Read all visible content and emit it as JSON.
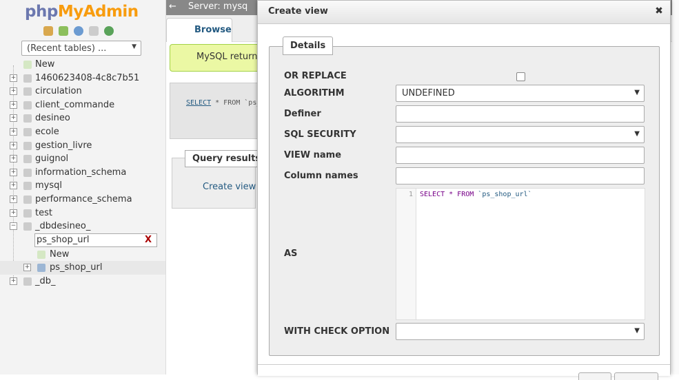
{
  "nav": {
    "logo_php": "php",
    "logo_myadmin": "MyAdmin",
    "recent_tables": "(Recent tables) ...",
    "tree": [
      {
        "label": "New",
        "expander": ""
      },
      {
        "label": "1460623408-4c8c7b51",
        "expander": "+"
      },
      {
        "label": "circulation",
        "expander": "+"
      },
      {
        "label": "client_commande",
        "expander": "+"
      },
      {
        "label": "desineo",
        "expander": "+"
      },
      {
        "label": "ecole",
        "expander": "+"
      },
      {
        "label": "gestion_livre",
        "expander": "+"
      },
      {
        "label": "guignol",
        "expander": "+"
      },
      {
        "label": "information_schema",
        "expander": "+"
      },
      {
        "label": "mysql",
        "expander": "+"
      },
      {
        "label": "performance_schema",
        "expander": "+"
      },
      {
        "label": "test",
        "expander": "+"
      },
      {
        "label": "_dbdesineo_",
        "expander": "−"
      }
    ],
    "filter_value": "ps_shop_url",
    "filter_clear": "X",
    "sub_new": "New",
    "sub_table": "ps_shop_url",
    "last_db": "_db_"
  },
  "background": {
    "back_arrow": "←",
    "server": "Server: mysq",
    "tab_browse": "Browse",
    "success_text": "MySQL returne",
    "sql_select": "SELECT",
    "sql_rest": " * FROM `ps_",
    "query_results": "Query results o",
    "create_view_link": "Create view"
  },
  "dialog": {
    "title": "Create view",
    "close": "✖",
    "legend": "Details",
    "or_replace_label": "OR REPLACE",
    "algorithm_label": "ALGORITHM",
    "algorithm_value": "UNDEFINED",
    "definer_label": "Definer",
    "definer_value": "",
    "sql_security_label": "SQL SECURITY",
    "sql_security_value": "",
    "view_name_label": "VIEW name",
    "view_name_value": "",
    "column_names_label": "Column names",
    "column_names_value": "",
    "as_label": "AS",
    "code_line_no": "1",
    "code_kw": "SELECT * FROM ",
    "code_table": "`ps_shop_url`",
    "check_option_label": "WITH CHECK OPTION",
    "check_option_value": ""
  },
  "colors": {
    "logo_php": "#6c78af",
    "logo_myadmin": "#f89c0e",
    "success_bg": "#ebf8a4",
    "link": "#235a81"
  }
}
